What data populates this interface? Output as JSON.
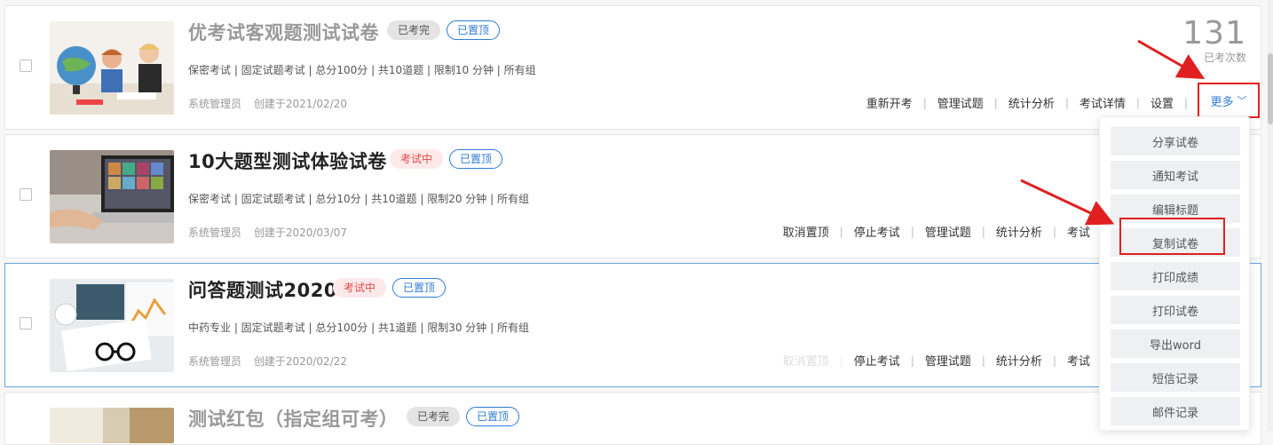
{
  "exams": [
    {
      "title": "优考试客观题测试试卷",
      "status": "已考完",
      "pinned": "已置顶",
      "meta": "保密考试 | 固定试题考试 | 总分100分 | 共10道题 | 限制10 分钟 | 所有组",
      "author": "系统管理员",
      "created": "创建于2021/02/20",
      "count": "131",
      "count_label": "已考次数",
      "actions": [
        "重新开考",
        "管理试题",
        "统计分析",
        "考试详情",
        "设置"
      ],
      "more_label": "更多"
    },
    {
      "title": "10大题型测试体验试卷",
      "status": "考试中",
      "pinned": "已置顶",
      "meta": "保密考试 | 固定试题考试 | 总分10分 | 共10道题 | 限制20 分钟 | 所有组",
      "author": "系统管理员",
      "created": "创建于2020/03/07",
      "actions": [
        "取消置顶",
        "停止考试",
        "管理试题",
        "统计分析",
        "考试"
      ]
    },
    {
      "title": "问答题测试2020",
      "status": "考试中",
      "pinned": "已置顶",
      "meta": "中药专业 | 固定试题考试 | 总分100分 | 共1道题 | 限制30 分钟 | 所有组",
      "author": "系统管理员",
      "created": "创建于2020/02/22",
      "actions": [
        "取消置顶",
        "停止考试",
        "管理试题",
        "统计分析",
        "考试"
      ]
    },
    {
      "title": "测试红包（指定组可考）",
      "status": "已考完",
      "pinned": "已置顶"
    }
  ],
  "dropdown": [
    "分享试卷",
    "通知考试",
    "编辑标题",
    "复制试卷",
    "打印成绩",
    "打印试卷",
    "导出word",
    "短信记录",
    "邮件记录"
  ],
  "colors": {
    "accent": "#2f7bd6",
    "highlight": "#e02020",
    "doing": "#e0494a"
  }
}
